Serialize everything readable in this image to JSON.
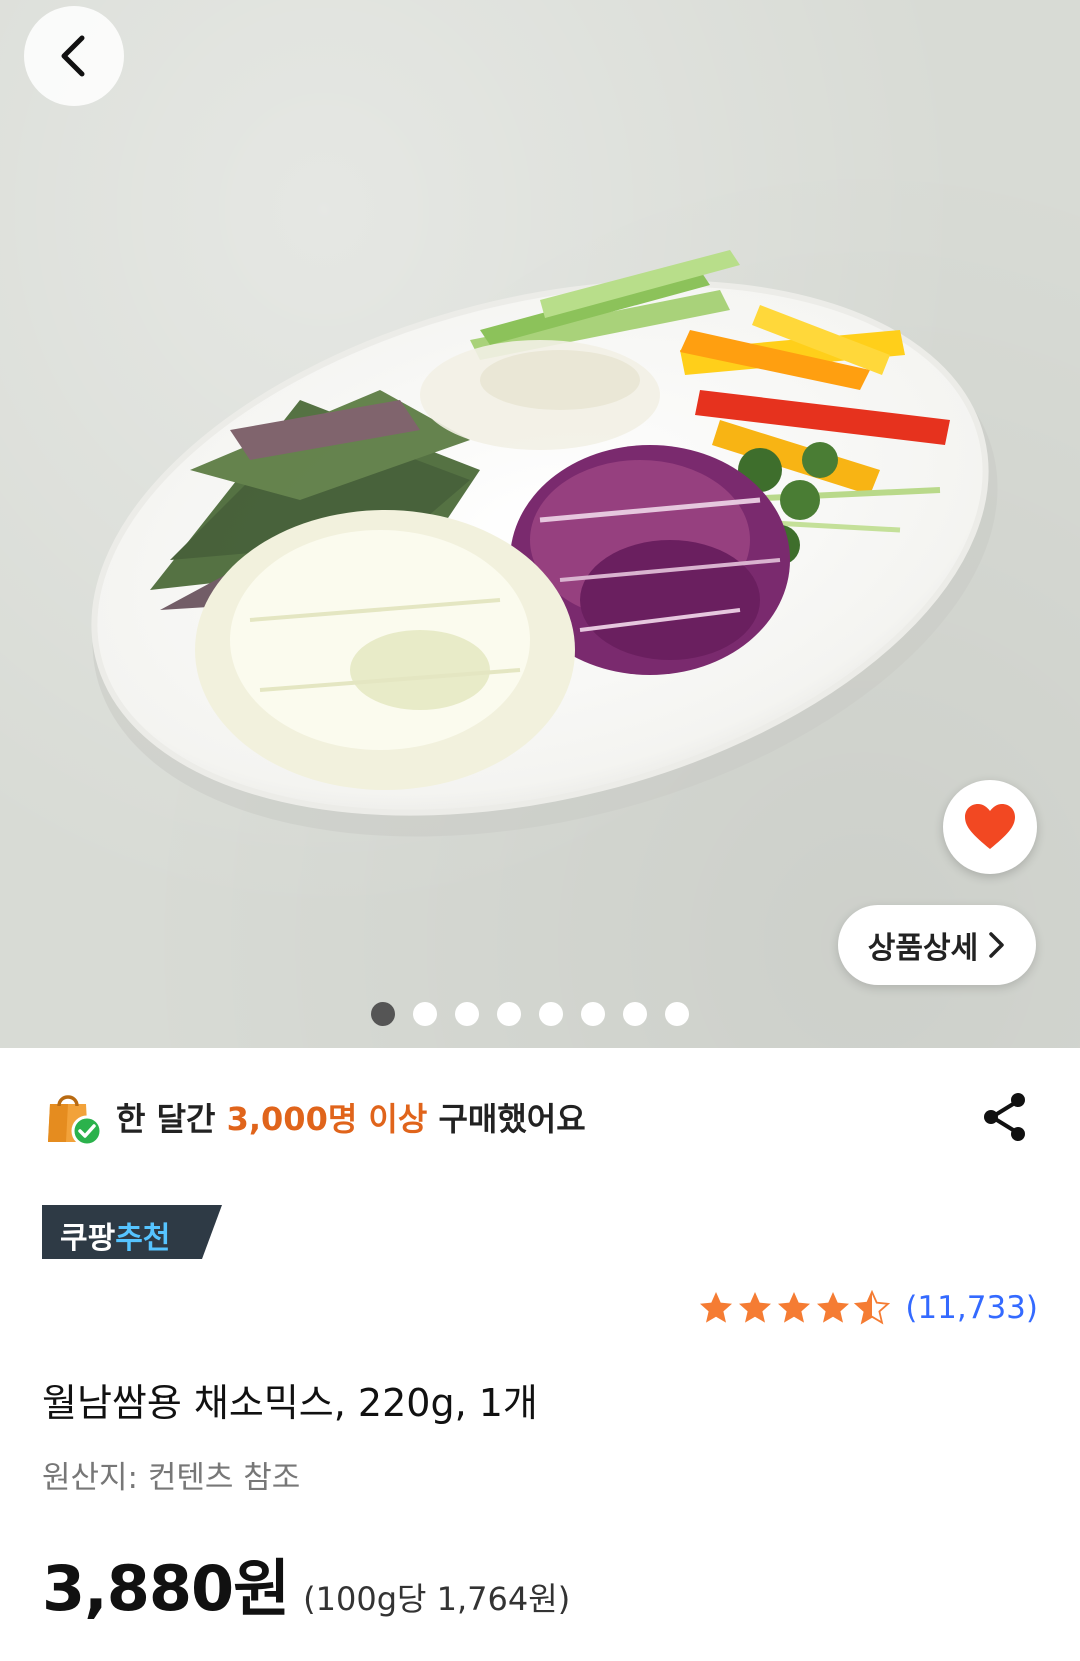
{
  "hero": {
    "image_alt": "salad vegetable mix on plate",
    "dots_total": 8,
    "dots_active_index": 0,
    "detail_button_label": "상품상세"
  },
  "icons": {
    "back": "back-chevron-icon",
    "like": "heart-icon",
    "detail_arrow": "chevron-right-icon",
    "bag": "shopping-bag-check-icon",
    "share": "share-icon",
    "star": "star-icon"
  },
  "colors": {
    "heart": "#f24822",
    "highlight": "#e0641b",
    "badge_bg": "#2e3a45",
    "badge_accent": "#56c4ff",
    "star": "#f57c33",
    "rating_count": "#346aff"
  },
  "buyers": {
    "prefix": "한 달간 ",
    "highlight": "3,000명 이상",
    "suffix": " 구매했어요"
  },
  "badge": {
    "part1": "쿠팡",
    "part2": "추천"
  },
  "rating": {
    "stars": 4.5,
    "count": "(11,733)"
  },
  "product": {
    "title": "월남쌈용 채소믹스, 220g, 1개",
    "origin": "원산지: 컨텐츠 참조",
    "price": "3,880원",
    "unit_price": "(100g당 1,764원)"
  }
}
